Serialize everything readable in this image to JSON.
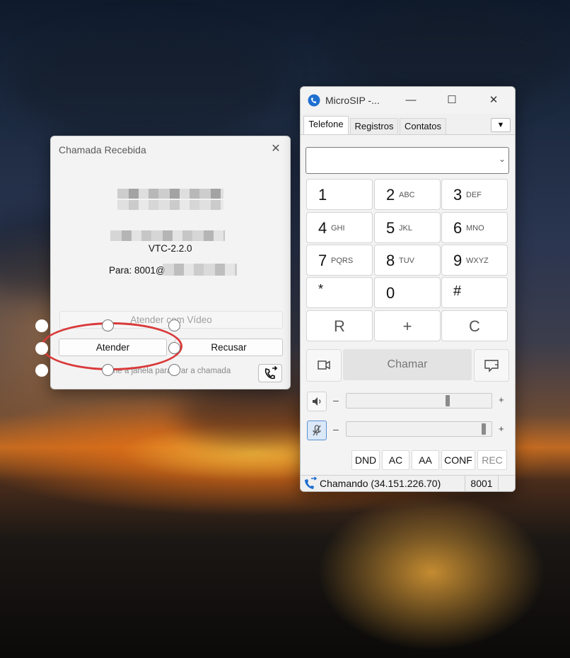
{
  "incoming_dialog": {
    "title": "Chamada Recebida",
    "close_glyph": "✕",
    "user_agent": "VTC-2.2.0",
    "to_label": "Para: 8001@",
    "answer_video_label": "Atender com Vídeo",
    "answer_label": "Atender",
    "decline_label": "Recusar",
    "hint_text": "ne a janela para  orar a chamada",
    "transfer_icon": "phone-forward-icon"
  },
  "microsip": {
    "title": "MicroSIP -...",
    "minimize_glyph": "—",
    "maximize_glyph": "☐",
    "close_glyph": "✕",
    "tabs": [
      {
        "label": "Telefone"
      },
      {
        "label": "Registros"
      },
      {
        "label": "Contatos"
      }
    ],
    "tab_menu_glyph": "▼",
    "dial_value": "",
    "combo_arrow": "⌄",
    "keypad": [
      {
        "main": "1",
        "sub": ""
      },
      {
        "main": "2",
        "sub": "ABC"
      },
      {
        "main": "3",
        "sub": "DEF"
      },
      {
        "main": "4",
        "sub": "GHI"
      },
      {
        "main": "5",
        "sub": "JKL"
      },
      {
        "main": "6",
        "sub": "MNO"
      },
      {
        "main": "7",
        "sub": "PQRS"
      },
      {
        "main": "8",
        "sub": "TUV"
      },
      {
        "main": "9",
        "sub": "WXYZ"
      },
      {
        "main": "*",
        "sub": ""
      },
      {
        "main": "0",
        "sub": ""
      },
      {
        "main": "#",
        "sub": ""
      },
      {
        "main": "R",
        "sub": ""
      },
      {
        "main": "+",
        "sub": ""
      },
      {
        "main": "C",
        "sub": ""
      }
    ],
    "call_label": "Chamar",
    "volume": {
      "speaker_level": 0.72,
      "mic_level": 0.98,
      "minus": "–",
      "plus": "+"
    },
    "toggles": [
      {
        "label": "DND"
      },
      {
        "label": "AC"
      },
      {
        "label": "AA"
      },
      {
        "label": "CONF"
      },
      {
        "label": "REC"
      }
    ],
    "status_text": "Chamando (34.151.226.70)",
    "status_ext": "8001",
    "accent_color": "#1f6fd1"
  }
}
